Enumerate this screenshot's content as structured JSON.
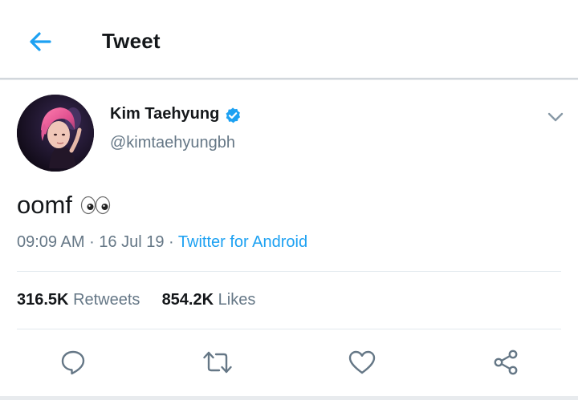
{
  "header": {
    "title": "Tweet",
    "back_icon": "arrow-left-icon"
  },
  "tweet": {
    "author_name": "Kim Taehyung",
    "verified": true,
    "handle": "@kimtaehyungbh",
    "text": "oomf",
    "emoji": "eyes-emoji",
    "time": "09:09 AM",
    "date": "16 Jul 19",
    "source": "Twitter for Android",
    "separator": "·"
  },
  "stats": {
    "retweets_count": "316.5K",
    "retweets_label": "Retweets",
    "likes_count": "854.2K",
    "likes_label": "Likes"
  },
  "actions": [
    "reply-icon",
    "retweet-icon",
    "like-icon",
    "share-icon"
  ],
  "colors": {
    "accent": "#1da1f2",
    "text_primary": "#14171a",
    "text_secondary": "#657786",
    "divider": "#e1e8ed"
  }
}
